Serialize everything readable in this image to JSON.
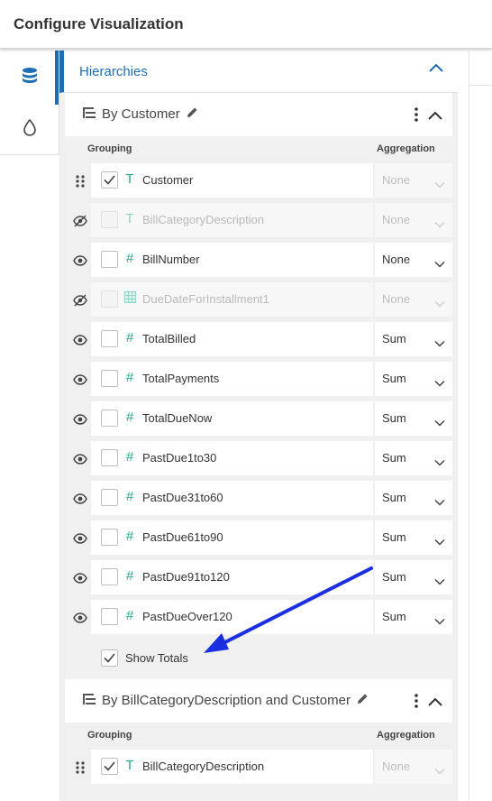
{
  "header": {
    "title": "Configure Visualization"
  },
  "nav": {
    "tabs": [
      {
        "icon": "database-icon"
      },
      {
        "icon": "droplet-icon"
      }
    ]
  },
  "hierarchies": {
    "title": "Hierarchies"
  },
  "section1": {
    "title": "By Customer",
    "col_grouping": "Grouping",
    "col_aggregation": "Aggregation",
    "rows": [
      {
        "label": "Customer",
        "type": "T",
        "checked": true,
        "visible": "drag",
        "agg": "None",
        "disabled": false,
        "agg_disabled": true
      },
      {
        "label": "BillCategoryDescription",
        "type": "T",
        "checked": false,
        "visible": "hidden",
        "agg": "None",
        "disabled": true,
        "agg_disabled": true
      },
      {
        "label": "BillNumber",
        "type": "#",
        "checked": false,
        "visible": "eye",
        "agg": "None",
        "disabled": false,
        "agg_disabled": false
      },
      {
        "label": "DueDateForInstallment1",
        "type": "cal",
        "checked": false,
        "visible": "hidden",
        "agg": "None",
        "disabled": true,
        "agg_disabled": true
      },
      {
        "label": "TotalBilled",
        "type": "#",
        "checked": false,
        "visible": "eye",
        "agg": "Sum",
        "disabled": false,
        "agg_disabled": false
      },
      {
        "label": "TotalPayments",
        "type": "#",
        "checked": false,
        "visible": "eye",
        "agg": "Sum",
        "disabled": false,
        "agg_disabled": false
      },
      {
        "label": "TotalDueNow",
        "type": "#",
        "checked": false,
        "visible": "eye",
        "agg": "Sum",
        "disabled": false,
        "agg_disabled": false
      },
      {
        "label": "PastDue1to30",
        "type": "#",
        "checked": false,
        "visible": "eye",
        "agg": "Sum",
        "disabled": false,
        "agg_disabled": false
      },
      {
        "label": "PastDue31to60",
        "type": "#",
        "checked": false,
        "visible": "eye",
        "agg": "Sum",
        "disabled": false,
        "agg_disabled": false
      },
      {
        "label": "PastDue61to90",
        "type": "#",
        "checked": false,
        "visible": "eye",
        "agg": "Sum",
        "disabled": false,
        "agg_disabled": false
      },
      {
        "label": "PastDue91to120",
        "type": "#",
        "checked": false,
        "visible": "eye",
        "agg": "Sum",
        "disabled": false,
        "agg_disabled": false
      },
      {
        "label": "PastDueOver120",
        "type": "#",
        "checked": false,
        "visible": "eye",
        "agg": "Sum",
        "disabled": false,
        "agg_disabled": false
      }
    ],
    "show_totals": "Show Totals",
    "show_totals_checked": true
  },
  "section2": {
    "title": "By BillCategoryDescription and Customer",
    "col_grouping": "Grouping",
    "col_aggregation": "Aggregation",
    "rows": [
      {
        "label": "BillCategoryDescription",
        "type": "T",
        "checked": true,
        "visible": "drag",
        "agg": "None",
        "disabled": false,
        "agg_disabled": true
      }
    ]
  },
  "colors": {
    "accent": "#1e6eb5",
    "type_icon": "#20a98d",
    "annotation_arrow": "#1a2fe0"
  }
}
